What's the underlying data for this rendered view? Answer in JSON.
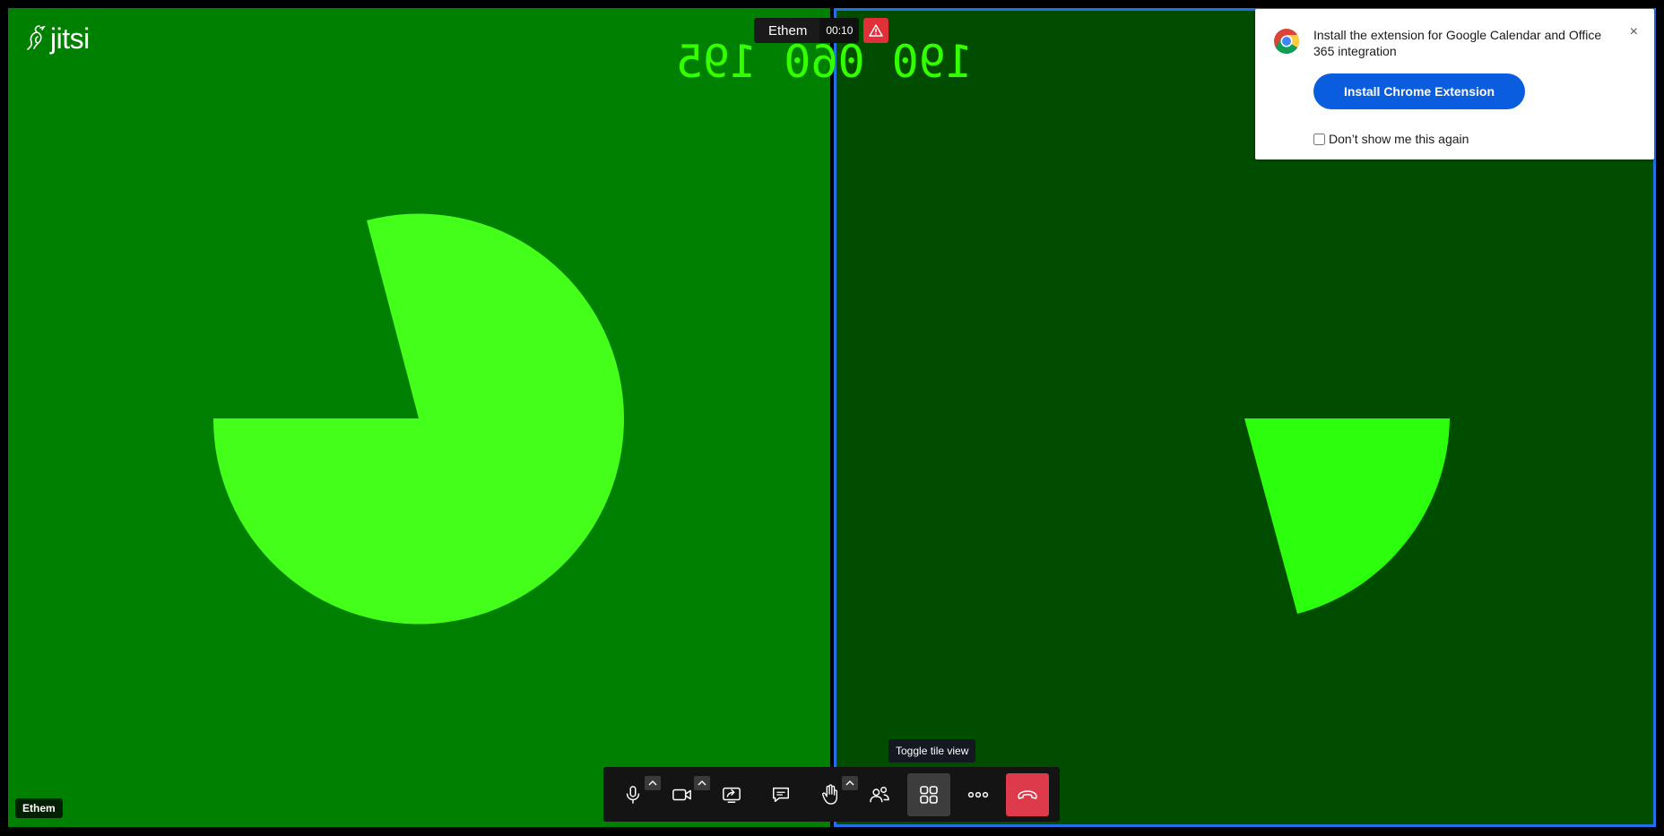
{
  "app": {
    "logo_text": "jitsi"
  },
  "header": {
    "subject": "Ethem",
    "timer": "00:10"
  },
  "video": {
    "mirrored_number": "190 060 195",
    "left_tile_color": "#008000",
    "right_tile_color": "#004d00",
    "shape_color": "#44ff1a",
    "active_outline_color": "#246fe5"
  },
  "participant": {
    "name": "Ethem"
  },
  "notification": {
    "message": "Install the extension for Google Calendar and Office 365 integration",
    "install_label": "Install Chrome Extension",
    "checkbox_label": "Don’t show me this again",
    "checkbox_checked": false,
    "close_label": "×"
  },
  "tooltip": {
    "text": "Toggle tile view"
  },
  "toolbar": {
    "buttons": [
      {
        "icon": "microphone-icon",
        "has_caret": true
      },
      {
        "icon": "camera-icon",
        "has_caret": true
      },
      {
        "icon": "share-screen-icon",
        "has_caret": false
      },
      {
        "icon": "chat-icon",
        "has_caret": false
      },
      {
        "icon": "raise-hand-icon",
        "has_caret": true
      },
      {
        "icon": "participants-icon",
        "has_caret": false
      },
      {
        "icon": "tile-view-icon",
        "has_caret": false,
        "active": true
      },
      {
        "icon": "more-options-icon",
        "has_caret": false
      },
      {
        "icon": "hangup-icon",
        "has_caret": false,
        "color": "#dd3a4b"
      }
    ]
  }
}
